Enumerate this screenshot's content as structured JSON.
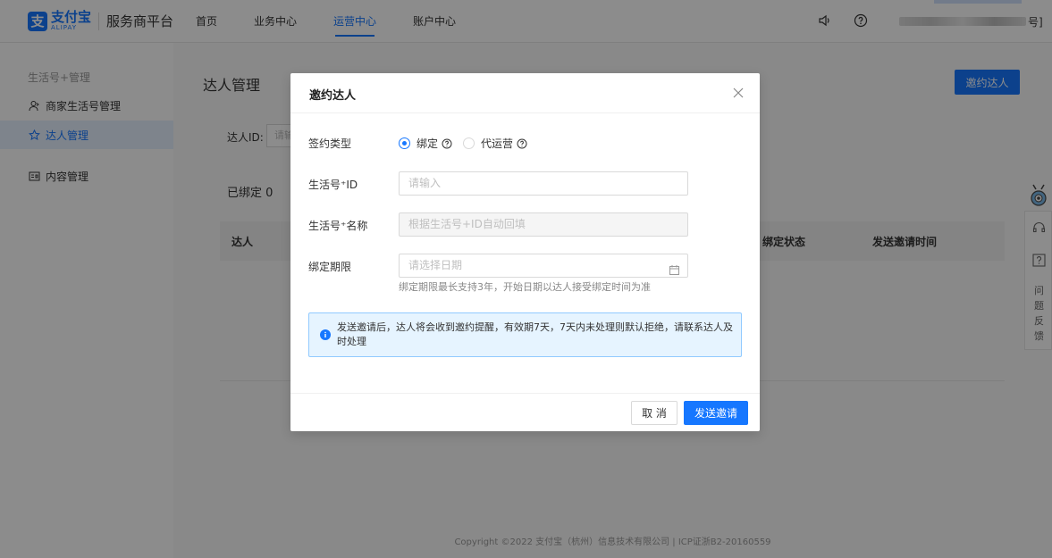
{
  "header": {
    "logo_mark": "支",
    "logo_cn": "支付宝",
    "logo_en": "ALIPAY",
    "platform": "服务商平台",
    "nav": [
      {
        "label": "首页"
      },
      {
        "label": "业务中心"
      },
      {
        "label": "运营中心"
      },
      {
        "label": "账户中心"
      }
    ],
    "active_nav": "运营中心",
    "account_suffix": "号]"
  },
  "sidebar": {
    "group": "生活号+管理",
    "items": [
      {
        "label": "商家生活号管理"
      },
      {
        "label": "达人管理"
      },
      {
        "label": "内容管理"
      }
    ],
    "active_item": "达人管理"
  },
  "main": {
    "title": "达人管理",
    "invite_button": "邀约达人",
    "filter_label": "达人ID:",
    "filter_placeholder": "请输",
    "bound_count": "已绑定 0",
    "columns": [
      {
        "label": "达人"
      },
      {
        "label": "绑定状态"
      },
      {
        "label": "发送邀请时间"
      }
    ],
    "footer": "Copyright ©2022 支付宝（杭州）信息技术有限公司 | ICP证浙B2-20160559"
  },
  "float_tool": {
    "feedback": "问题反馈"
  },
  "modal": {
    "title": "邀约达人",
    "fields": {
      "sign_type_label": "签约类型",
      "sign_options": [
        {
          "label": "绑定",
          "checked": true
        },
        {
          "label": "代运营",
          "checked": false
        }
      ],
      "id_label": "生活号⁺ID",
      "id_placeholder": "请输入",
      "name_label": "生活号⁺名称",
      "name_placeholder": "根据生活号+ID自动回填",
      "period_label": "绑定期限",
      "period_placeholder": "请选择日期",
      "period_hint": "绑定期限最长支持3年，开始日期以达人接受绑定时间为准"
    },
    "notice": "发送邀请后，达人将会收到邀约提醒，有效期7天，7天内未处理则默认拒绝，请联系达人及时处理",
    "cancel_label": "取 消",
    "send_label": "发送邀请"
  },
  "colors": {
    "primary": "#1677ff",
    "notice_bg": "#e6f4ff",
    "mask": "rgba(0,0,0,0.45)"
  }
}
